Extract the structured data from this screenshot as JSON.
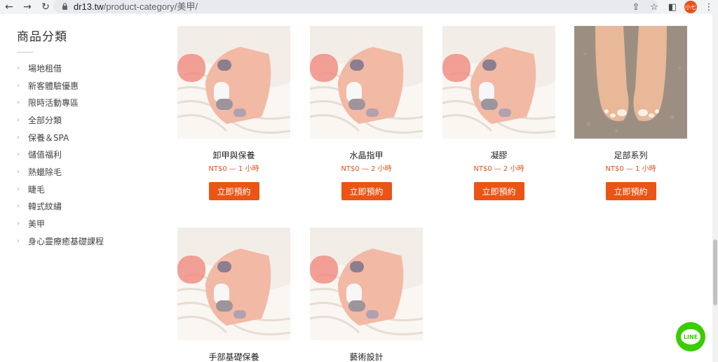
{
  "browser": {
    "url_domain": "dr13.tw",
    "url_path": "/product-category/美甲/",
    "profile_label": "小七"
  },
  "sidebar": {
    "title": "商品分類",
    "items": [
      {
        "label": "場地租借"
      },
      {
        "label": "新客體驗優惠"
      },
      {
        "label": "限時活動專區"
      },
      {
        "label": "全部分類"
      },
      {
        "label": "保養＆SPA"
      },
      {
        "label": "儲值福利"
      },
      {
        "label": "熱蠟除毛"
      },
      {
        "label": "睫毛"
      },
      {
        "label": "韓式紋繡"
      },
      {
        "label": "美甲"
      },
      {
        "label": "身心靈療癒基礎課程"
      }
    ]
  },
  "products": [
    {
      "name": "卸甲與保養",
      "price": "NT$0 — 1 小時",
      "button": "立即預約",
      "image": "hand"
    },
    {
      "name": "水晶指甲",
      "price": "NT$0 — 2 小時",
      "button": "立即預約",
      "image": "hand"
    },
    {
      "name": "凝膠",
      "price": "NT$0 — 2 小時",
      "button": "立即預約",
      "image": "hand"
    },
    {
      "name": "足部系列",
      "price": "NT$0 — 1 小時",
      "button": "立即預約",
      "image": "feet"
    },
    {
      "name": "手部基礎保養",
      "image": "hand"
    },
    {
      "name": "藝術設計",
      "image": "hand"
    }
  ],
  "line_button": {
    "label": "LINE"
  },
  "colors": {
    "accent": "#ea5415",
    "price": "#d9541e",
    "line": "#3acd01"
  }
}
